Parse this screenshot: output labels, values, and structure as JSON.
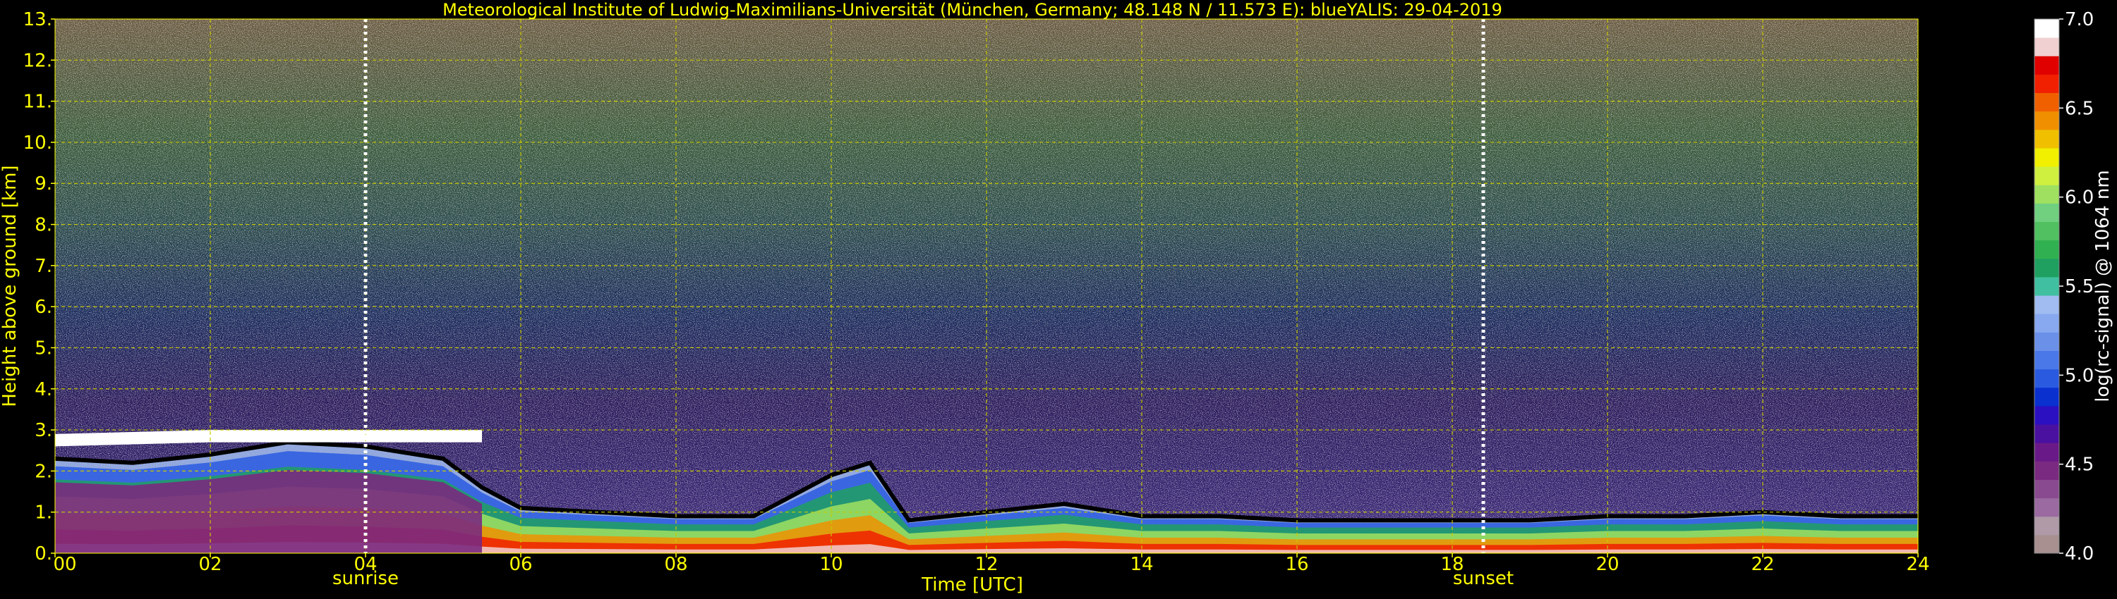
{
  "chart_data": {
    "type": "heatmap",
    "title": "Meteorological Institute of Ludwig-Maximilians-Universität (München, Germany; 48.148 N / 11.573 E):    blueYALIS: 29-04-2019",
    "xlabel": "Time [UTC]",
    "ylabel": "Height above ground [km]",
    "xlim": [
      0,
      24
    ],
    "ylim": [
      0,
      13
    ],
    "x_ticks": [
      0,
      2,
      4,
      6,
      8,
      10,
      12,
      14,
      16,
      18,
      20,
      22,
      24
    ],
    "x_tick_labels": [
      "00",
      "02",
      "04",
      "06",
      "08",
      "10",
      "12",
      "14",
      "16",
      "18",
      "20",
      "22",
      "24"
    ],
    "y_ticks": [
      0,
      1,
      2,
      3,
      4,
      5,
      6,
      7,
      8,
      9,
      10,
      11,
      12,
      13
    ],
    "y_tick_labels": [
      "0.",
      "1.",
      "2.",
      "3.",
      "4.",
      "5.",
      "6.",
      "7.",
      "8.",
      "9.",
      "10.",
      "11.",
      "12.",
      "13."
    ],
    "grid": true,
    "events": [
      {
        "label": "sunrise",
        "time": 4.0
      },
      {
        "label": "sunset",
        "time": 18.4
      }
    ],
    "colorbar": {
      "label": "log(rc-signal) @ 1064 nm",
      "min": 4.0,
      "max": 7.0,
      "ticks": [
        4.0,
        4.5,
        5.0,
        5.5,
        6.0,
        6.5,
        7.0
      ],
      "tick_labels": [
        "4.0",
        "4.5",
        "5.0",
        "5.5",
        "6.0",
        "6.5",
        "7.0"
      ],
      "colors": [
        "#a89090",
        "#b09aa8",
        "#9a6aa0",
        "#8a4a90",
        "#7a2a80",
        "#6a1a88",
        "#4a10a0",
        "#2a10c0",
        "#0a30d0",
        "#2a5ae0",
        "#4a78e8",
        "#6a90e8",
        "#88a8f0",
        "#a0bcf0",
        "#40c0a0",
        "#20a060",
        "#30b050",
        "#50c060",
        "#70d080",
        "#a0e060",
        "#d0f040",
        "#f0f000",
        "#f0c000",
        "#f09000",
        "#f06000",
        "#f02000",
        "#e00000",
        "#f0d0d0",
        "#ffffff"
      ]
    },
    "features": {
      "boundary_layer_top_km": [
        [
          0.0,
          2.3
        ],
        [
          1.0,
          2.2
        ],
        [
          2.0,
          2.4
        ],
        [
          3.0,
          2.7
        ],
        [
          4.0,
          2.6
        ],
        [
          5.0,
          2.3
        ],
        [
          5.5,
          1.6
        ],
        [
          6.0,
          1.1
        ],
        [
          7.0,
          1.0
        ],
        [
          8.0,
          0.9
        ],
        [
          9.0,
          0.9
        ],
        [
          10.0,
          1.9
        ],
        [
          10.5,
          2.2
        ],
        [
          11.0,
          0.8
        ],
        [
          12.0,
          1.0
        ],
        [
          13.0,
          1.2
        ],
        [
          14.0,
          0.9
        ],
        [
          15.0,
          0.9
        ],
        [
          16.0,
          0.8
        ],
        [
          17.0,
          0.8
        ],
        [
          18.0,
          0.8
        ],
        [
          19.0,
          0.8
        ],
        [
          20.0,
          0.9
        ],
        [
          21.0,
          0.9
        ],
        [
          22.0,
          1.0
        ],
        [
          23.0,
          0.9
        ],
        [
          24.0,
          0.9
        ]
      ],
      "residual_layer_km": [
        [
          0.0,
          2.9
        ],
        [
          2.0,
          3.0
        ],
        [
          4.0,
          3.0
        ],
        [
          5.5,
          3.0
        ]
      ]
    }
  }
}
